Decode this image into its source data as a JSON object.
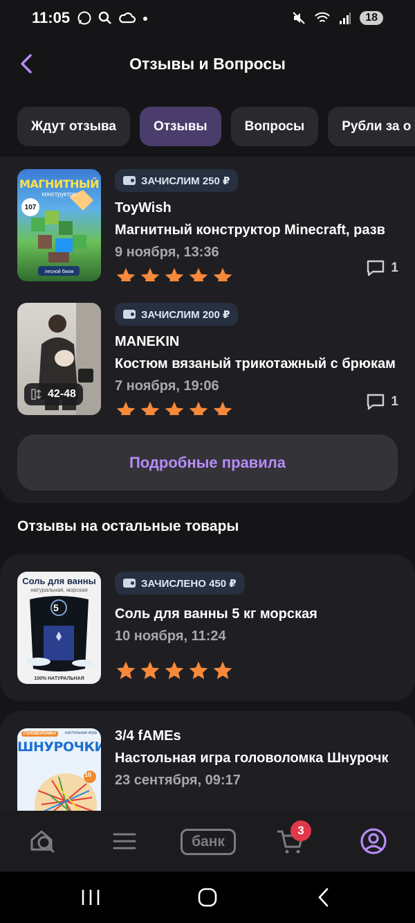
{
  "status": {
    "time": "11:05",
    "battery": "18"
  },
  "header": {
    "title": "Отзывы и Вопросы"
  },
  "tabs": [
    {
      "label": "Ждут отзыва"
    },
    {
      "label": "Отзывы"
    },
    {
      "label": "Вопросы"
    },
    {
      "label": "Рубли за о"
    }
  ],
  "reviews": [
    {
      "badge": "ЗАЧИСЛИМ 250 ₽",
      "seller": "ToyWish",
      "product": "Магнитный конструктор Minecraft, разв",
      "date": "9 ноября, 13:36",
      "rating": 5,
      "comments": "1",
      "thumb_title": "МАГНИТНЫЙ",
      "thumb_sub": "конструктор",
      "thumb_count": "107",
      "thumb_footer": "лесной биом"
    },
    {
      "badge": "ЗАЧИСЛИМ 200 ₽",
      "seller": "MANEKIN",
      "product": "Костюм вязаный трикотажный с брюкам",
      "date": "7 ноября, 19:06",
      "rating": 5,
      "comments": "1",
      "size": "42-48"
    }
  ],
  "rules_button": "Подробные правила",
  "other_section_title": "Отзывы на остальные товары",
  "other_reviews": [
    {
      "badge": "ЗАЧИСЛЕНО 450 ₽",
      "product": "Соль для ванны 5 кг морская",
      "date": "10 ноября, 11:24",
      "rating": 5,
      "thumb_title": "Соль для ванны",
      "thumb_sub": "натуральная, морская",
      "thumb_num": "5",
      "thumb_footer": "100% НАТУРАЛЬНАЯ"
    },
    {
      "seller": "3/4 fAMEs",
      "product": "Настольная игра головоломка Шнурочк",
      "date": "23 сентября, 09:17",
      "thumb_title": "ШНУРОЧКИ",
      "thumb_tag1": "ГОЛОВОЛОМКА",
      "thumb_tag2": "настольная игра",
      "thumb_num": "10"
    }
  ],
  "nav": {
    "bank_label": "банк",
    "cart_count": "3"
  },
  "colors": {
    "accent": "#b78cf7",
    "star": "#f7893a",
    "badge_bg": "#263040",
    "cart_badge": "#e0384a"
  }
}
